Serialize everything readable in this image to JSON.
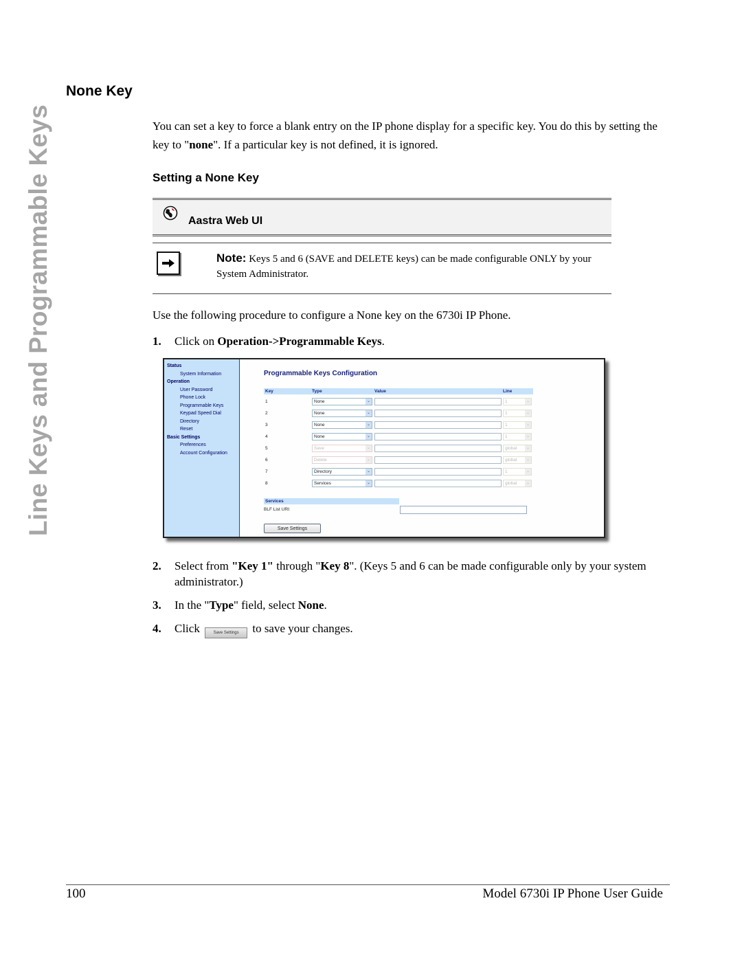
{
  "side_tab": {
    "text": "Line Keys and Programmable Keys"
  },
  "section_title": "None Key",
  "intro": {
    "before_bold": "You can set a key to force a blank entry on the IP phone display for a specific key. You do this by setting the key to \"",
    "bold": "none",
    "after_bold": "\". If a particular key is not defined, it is ignored."
  },
  "subsection_title": "Setting a None Key",
  "web_ui_box": {
    "icon": "globe-icon",
    "label": "Aastra Web UI"
  },
  "note": {
    "icon": "arrow-right-icon",
    "label": "Note:",
    "text": " Keys 5 and 6 (SAVE and DELETE keys) can be made configurable ONLY by your System Administrator."
  },
  "procedure_intro": "Use the following procedure to configure a None key on the 6730i IP Phone.",
  "steps": [
    {
      "num": "1.",
      "pre": "Click on ",
      "bold": "Operation->Programmable Keys",
      "post": "."
    },
    {
      "num": "2.",
      "pre": "Select from ",
      "bold1": "\"Key 1\"",
      "mid1": " through \"",
      "bold2": "Key 8",
      "post": "\". (Keys 5 and 6 can be made configurable only by your system administrator.)"
    },
    {
      "num": "3.",
      "pre": "In the \"",
      "bold1": "Type",
      "mid1": "\" field, select ",
      "bold2": "None",
      "post": "."
    },
    {
      "num": "4.",
      "pre": "Click ",
      "button_label": "Save Settings",
      "post": " to save your changes."
    }
  ],
  "screenshot": {
    "nav": [
      {
        "type": "head",
        "label": "Status"
      },
      {
        "type": "item",
        "label": "System Information"
      },
      {
        "type": "head",
        "label": "Operation"
      },
      {
        "type": "item",
        "label": "User Password"
      },
      {
        "type": "item",
        "label": "Phone Lock"
      },
      {
        "type": "item",
        "label": "Programmable Keys"
      },
      {
        "type": "item",
        "label": "Keypad Speed Dial"
      },
      {
        "type": "item",
        "label": "Directory"
      },
      {
        "type": "item",
        "label": "Reset"
      },
      {
        "type": "head",
        "label": "Basic Settings"
      },
      {
        "type": "item",
        "label": "Preferences"
      },
      {
        "type": "item",
        "label": "Account Configuration"
      }
    ],
    "title": "Programmable Keys Configuration",
    "columns": {
      "key": "Key",
      "type": "Type",
      "value": "Value",
      "line": "Line"
    },
    "rows": [
      {
        "key": "1",
        "type": "None",
        "type_disabled": false,
        "value": "",
        "line": "1"
      },
      {
        "key": "2",
        "type": "None",
        "type_disabled": false,
        "value": "",
        "line": "1"
      },
      {
        "key": "3",
        "type": "None",
        "type_disabled": false,
        "value": "",
        "line": "1"
      },
      {
        "key": "4",
        "type": "None",
        "type_disabled": false,
        "value": "",
        "line": "1"
      },
      {
        "key": "5",
        "type": "Save",
        "type_disabled": true,
        "value": "",
        "line": "global"
      },
      {
        "key": "6",
        "type": "Delete",
        "type_disabled": true,
        "value": "",
        "line": "global"
      },
      {
        "key": "7",
        "type": "Directory",
        "type_disabled": false,
        "value": "",
        "line": "1"
      },
      {
        "key": "8",
        "type": "Services",
        "type_disabled": false,
        "value": "",
        "line": "global"
      }
    ],
    "services_header": "Services",
    "blf_label": "BLF List URI:",
    "blf_value": "",
    "save_button": "Save Settings"
  },
  "footer": {
    "page_number": "100",
    "guide_title": "Model 6730i IP Phone User Guide"
  },
  "colors": {
    "nav_bg": "#c6e2fb",
    "heading_blue": "#1a237e",
    "side_tab_gray": "#a6a6a6"
  }
}
